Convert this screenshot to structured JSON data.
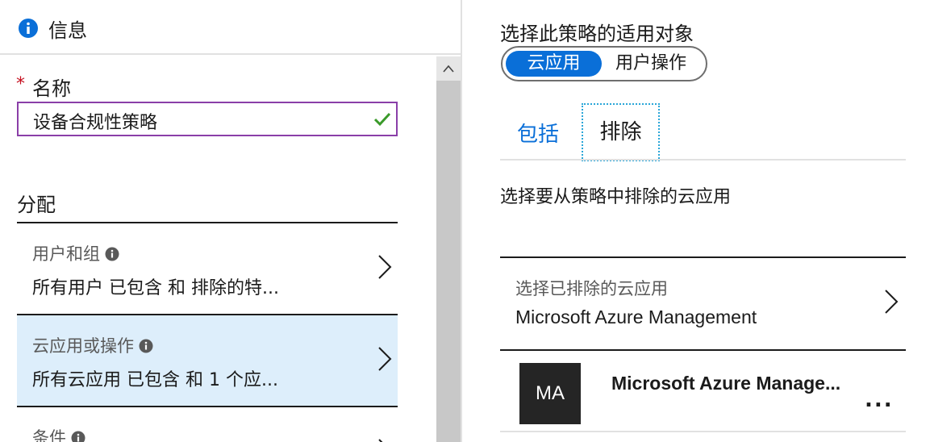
{
  "left": {
    "header": {
      "title": "信息",
      "icon": "info-icon"
    },
    "name_field": {
      "required_mark": "*",
      "label": "名称",
      "value": "设备合规性策略",
      "status_icon": "check-icon"
    },
    "assign": {
      "heading": "分配",
      "items": [
        {
          "label": "用户和组",
          "value": "所有用户 已包含 和 排除的特...",
          "selected": false
        },
        {
          "label": "云应用或操作",
          "value": "所有云应用 已包含 和 1 个应...",
          "selected": true
        },
        {
          "label": "条件",
          "value": "",
          "selected": false
        }
      ]
    }
  },
  "right": {
    "target_title": "选择此策略的适用对象",
    "toggle": {
      "selected": "云应用",
      "other": "用户操作"
    },
    "tabs": {
      "include": "包括",
      "exclude": "排除",
      "active": "排除"
    },
    "exclude_description": "选择要从策略中排除的云应用",
    "selector": {
      "label": "选择已排除的云应用",
      "value": "Microsoft Azure Management"
    },
    "app": {
      "initials": "MA",
      "name": "Microsoft Azure Manage...",
      "more": "..."
    }
  },
  "colors": {
    "accent": "#0a6fd8",
    "selected_row": "#ddeefb",
    "input_border": "#8a3fa8",
    "check": "#3a9a2a",
    "required": "#c50f1f",
    "app_tile": "#252525"
  }
}
